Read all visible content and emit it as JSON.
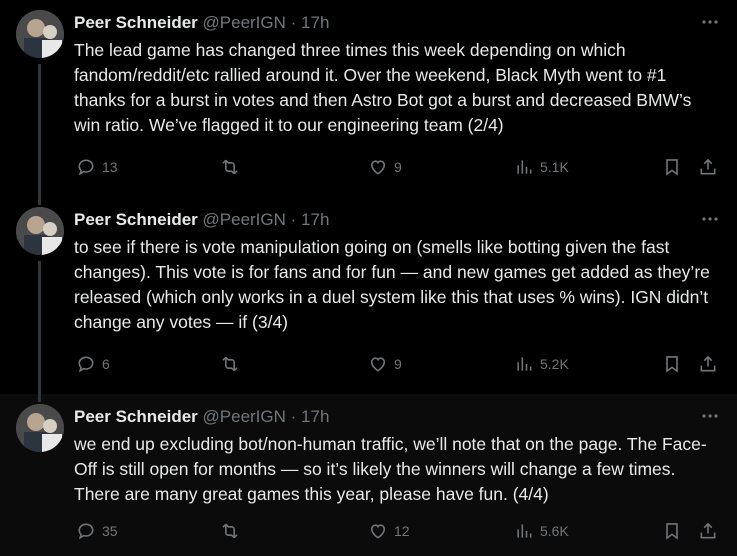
{
  "tweets": [
    {
      "author_name": "Peer Schneider",
      "author_handle": "@PeerIGN",
      "separator": "·",
      "time": "17h",
      "text": "The lead game has changed three times this week depending on which fandom/reddit/etc rallied around it. Over the weekend, Black Myth went to #1 thanks for a burst in votes and then Astro Bot got a burst and decreased BMW’s win ratio. We’ve flagged it to our engineering team (2/4)",
      "replies": "13",
      "reposts": "",
      "likes": "9",
      "views": "5.1K"
    },
    {
      "author_name": "Peer Schneider",
      "author_handle": "@PeerIGN",
      "separator": "·",
      "time": "17h",
      "text": "to see if there is vote manipulation going on (smells like botting given the fast changes). This vote is for fans and for fun — and new games get added as they’re released (which only works in a duel system like this that uses % wins).  IGN didn’t change any votes — if (3/4)",
      "replies": "6",
      "reposts": "",
      "likes": "9",
      "views": "5.2K"
    },
    {
      "author_name": "Peer Schneider",
      "author_handle": "@PeerIGN",
      "separator": "·",
      "time": "17h",
      "text": "we end up excluding bot/non-human traffic, we’ll note that on the page. The Face-Off is still open for months — so it’s likely the winners will change a few times. There are many great games this year, please have fun. (4/4)",
      "replies": "35",
      "reposts": "",
      "likes": "12",
      "views": "5.6K"
    }
  ],
  "icons": {
    "more": "more-icon",
    "reply": "reply-icon",
    "repost": "repost-icon",
    "like": "heart-icon",
    "views": "views-icon",
    "bookmark": "bookmark-icon",
    "share": "share-icon"
  },
  "colors": {
    "background": "#000000",
    "text": "#e7e9ea",
    "secondary": "#71767b",
    "thread_line": "#333639"
  }
}
